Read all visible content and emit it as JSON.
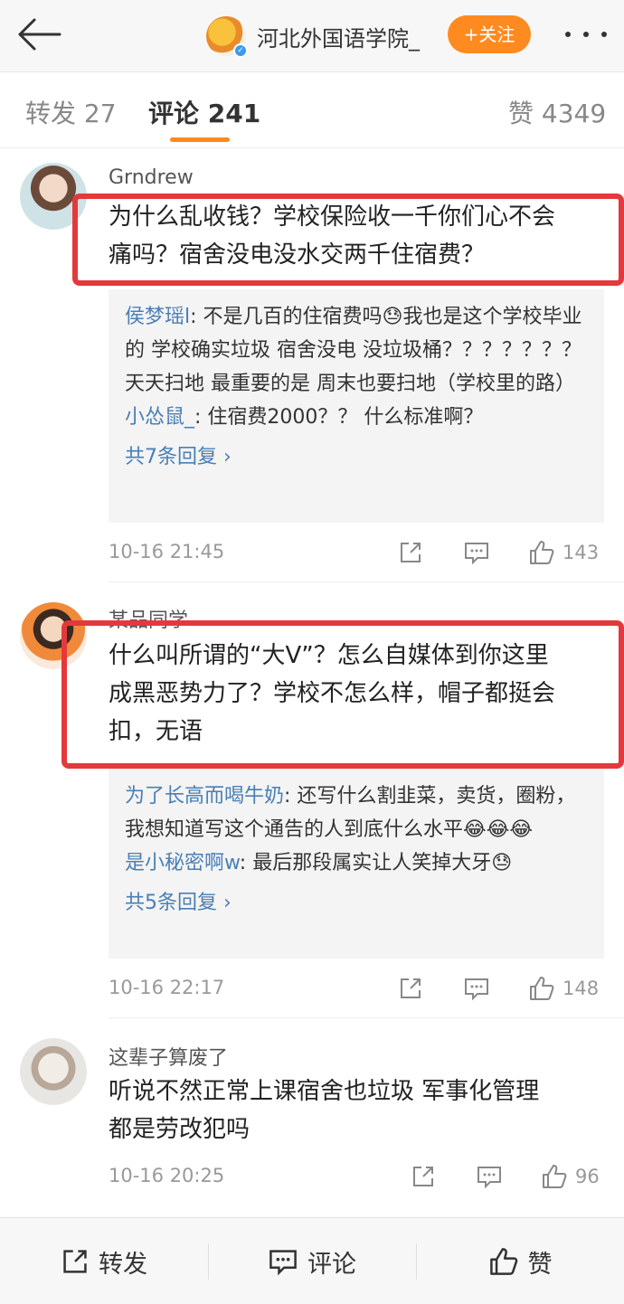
{
  "header": {
    "account_name": "河北外国语学院_",
    "follow_label": "+关注"
  },
  "tabs": [
    {
      "label": "转发 27"
    },
    {
      "label": "评论 241"
    },
    {
      "label": "赞 4349"
    }
  ],
  "comments": [
    {
      "user": "Grndrew",
      "text_lines": [
        "为什么乱收钱？学校保险收一千你们心不会",
        "痛吗？宿舍没电没水交两千住宿费？"
      ],
      "replies": [
        {
          "name": "侯梦瑶l",
          "text": ": 不是几百的住宿费吗😓我也是这个学校毕业的 学校确实垃圾 宿舍没电 没垃圾桶？？？？？？？ 天天扫地 最重要的是 周末也要扫地（学校里的路）"
        },
        {
          "name": "小怂鼠_",
          "text": ": 住宿费2000？？ 什么标准啊？"
        }
      ],
      "more_replies": "共7条回复 ›",
      "time": "10-16 21:45",
      "likes": "143"
    },
    {
      "user": "某品同学",
      "text_lines": [
        "什么叫所谓的“大V”？怎么自媒体到你这里",
        "成黑恶势力了？学校不怎么样，帽子都挺会",
        "扣，无语"
      ],
      "replies": [
        {
          "name": "为了长高而喝牛奶",
          "text": ": 还写什么割韭菜，卖货，圈粉，我想知道写这个通告的人到底什么水平😂😂😂"
        },
        {
          "name": "是小秘密啊w",
          "text": ": 最后那段属实让人笑掉大牙😓"
        }
      ],
      "more_replies": "共5条回复 ›",
      "time": "10-16 22:17",
      "likes": "148"
    },
    {
      "user": "这辈子算废了",
      "text_lines": [
        "听说不然正常上课宿舍也垃圾 军事化管理",
        "都是劳改犯吗"
      ],
      "time": "10-16 20:25",
      "likes": "96"
    }
  ],
  "bottom_bar": {
    "repost": "转发",
    "comment": "评论",
    "like": "赞"
  },
  "colors": {
    "accent_orange": "#ff8a1f",
    "link_blue": "#4a7fb5",
    "highlight_red": "#e4393c"
  }
}
